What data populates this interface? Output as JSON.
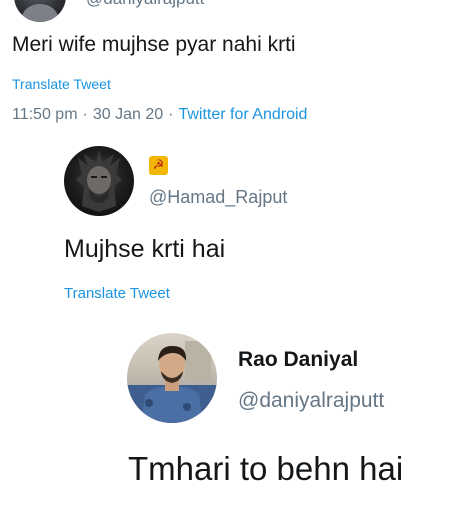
{
  "tweet1": {
    "handle": "@daniyalrajputt",
    "text": "Meri wife mujhse pyar nahi krti",
    "translate_label": "Translate Tweet",
    "time": "11:50 pm",
    "separator": "·",
    "date": "30 Jan 20",
    "client": "Twitter for Android",
    "avatar_icon": "profile-photo-icon"
  },
  "tweet2": {
    "badge_glyph": "☭",
    "handle": "@Hamad_Rajput",
    "text": "Mujhse krti hai",
    "translate_label": "Translate Tweet",
    "avatar_icon": "profile-photo-icon"
  },
  "tweet3": {
    "display_name": "Rao Daniyal",
    "handle": "@daniyalrajputt",
    "text": "Tmhari to behn hai",
    "avatar_icon": "profile-photo-icon"
  },
  "colors": {
    "link_blue": "#1b95e0",
    "secondary_text": "#657786",
    "primary_text": "#14171a",
    "badge_yellow": "#f2b705",
    "badge_red": "#b81c1c"
  }
}
